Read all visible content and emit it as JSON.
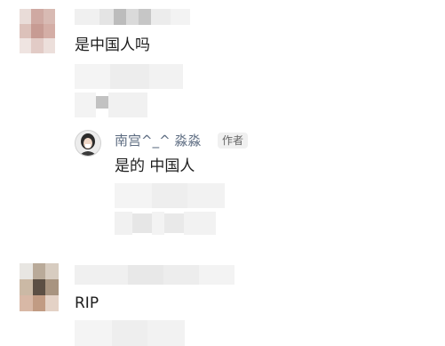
{
  "comments": [
    {
      "text": "是中国人吗"
    },
    {
      "text": "RIP"
    }
  ],
  "reply": {
    "author": "南宫^_^ 淼淼",
    "badge": "作者",
    "text": "是的 中国人",
    "avatar_icon": "user-avatar-icon"
  },
  "colors": {
    "reply_name": "#5e6d82",
    "badge_bg": "#f0f0f0"
  }
}
